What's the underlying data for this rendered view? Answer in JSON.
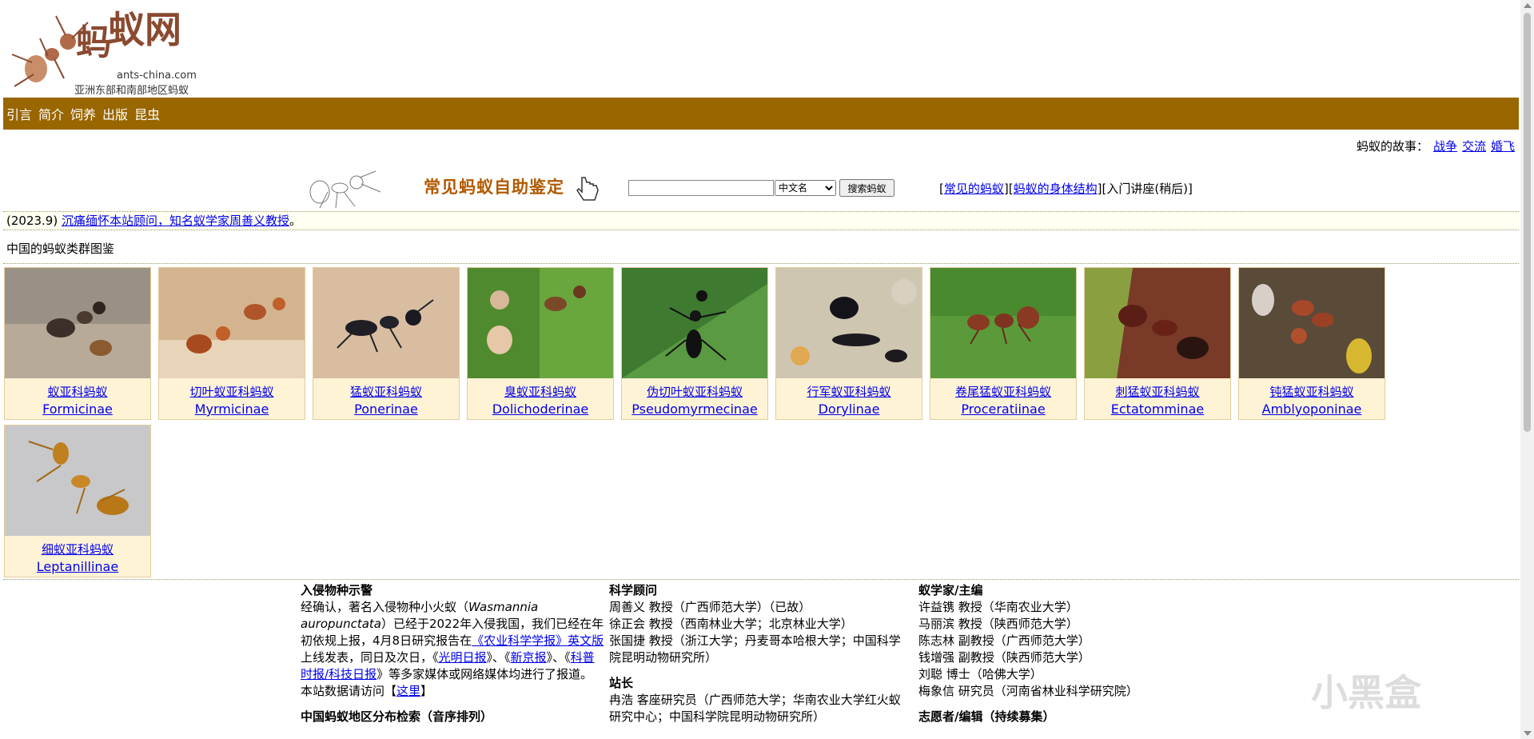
{
  "logo": {
    "title": "蚂蚁网",
    "url": "ants-china.com",
    "subtitle": "亚洲东部和南部地区蚂蚁"
  },
  "nav": [
    "引言",
    "简介",
    "饲养",
    "出版",
    "昆虫"
  ],
  "story": {
    "label": "蚂蚁的故事：",
    "links": [
      "战争",
      "交流",
      "婚飞"
    ]
  },
  "identify": {
    "title": "常见蚂蚁自助鉴定",
    "search_value": "",
    "lang_selected": "中文名",
    "search_button": "搜索蚂蚁",
    "links_prefix": "[",
    "link1": "常见的蚂蚁",
    "mid": "][",
    "link2": "蚂蚁的身体结构",
    "suffix": "][入门讲座(稍后)]"
  },
  "notice": {
    "date": "(2023.9) ",
    "link": "沉痛缅怀本站顾问，知名蚁学家周善义教授",
    "end": "。"
  },
  "section_title": "中国的蚂蚁类群图鉴",
  "subfamilies": [
    {
      "cn": "蚁亚科蚂蚁",
      "lat": "Formicinae"
    },
    {
      "cn": "切叶蚁亚科蚂蚁",
      "lat": "Myrmicinae"
    },
    {
      "cn": "猛蚁亚科蚂蚁",
      "lat": "Ponerinae"
    },
    {
      "cn": "臭蚁亚科蚂蚁",
      "lat": "Dolichoderinae"
    },
    {
      "cn": "伪切叶蚁亚科蚂蚁",
      "lat": "Pseudomyrmecinae"
    },
    {
      "cn": "行军蚁亚科蚂蚁",
      "lat": "Dorylinae"
    },
    {
      "cn": "卷尾猛蚁亚科蚂蚁",
      "lat": "Proceratiinae"
    },
    {
      "cn": "刺猛蚁亚科蚂蚁",
      "lat": "Ectatomminae"
    },
    {
      "cn": "钝猛蚁亚科蚂蚁",
      "lat": "Amblyoponinae"
    },
    {
      "cn": "细蚁亚科蚂蚁",
      "lat": "Leptanillinae"
    }
  ],
  "col1": {
    "heading": "入侵物种示警",
    "p1": "经确认，著名入侵物种小火蚁（",
    "species": "Wasmannia auropunctata",
    "p2": "）已经于2022年入侵我国，我们已经在年初依规上报，4月8日研究报告在",
    "l1": "《农业科学学报》英文版",
    "p3": "上线发表，同日及次日，《",
    "l2": "光明日报",
    "p4": "》、《",
    "l3": "新京报",
    "p5": "》、《",
    "l4": "科普时报/科技日报",
    "p6": "》等多家媒体或网络媒体均进行了报道。本站数据请访问【",
    "l5": "这里",
    "p7": "】",
    "heading2": "中国蚂蚁地区分布检索（音序排列）"
  },
  "col2": {
    "heading": "科学顾问",
    "lines": [
      "周善义 教授（广西师范大学）（已故）",
      "徐正会 教授（西南林业大学；北京林业大学）",
      "张国捷 教授（浙江大学；丹麦哥本哈根大学；中国科学院昆明动物研究所）"
    ],
    "heading2": "站长",
    "lines2": [
      "冉浩 客座研究员（广西师范大学；华南农业大学红火蚁研究中心；中国科学院昆明动物研究所）"
    ]
  },
  "col3": {
    "heading": "蚁学家/主编",
    "lines": [
      "许益镌 教授（华南农业大学）",
      "马丽滨 教授（陕西师范大学）",
      "陈志林 副教授（广西师范大学）",
      "钱增强 副教授（陕西师范大学）",
      "刘聪 博士（哈佛大学）",
      "梅象信 研究员（河南省林业科学研究院）"
    ],
    "heading2": "志愿者/编辑（持续募集）"
  },
  "watermark": "小黑盒",
  "colors": {
    "nav_bg": "#996600",
    "card_bg": "#fff3d6",
    "link": "#0000ee"
  }
}
